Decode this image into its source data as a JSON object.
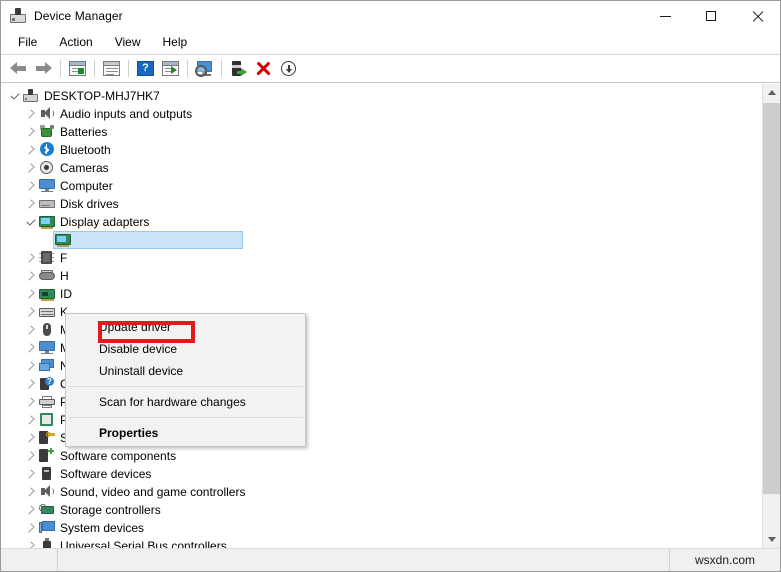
{
  "window": {
    "title": "Device Manager",
    "icon": "device-manager-icon",
    "controls": {
      "minimize": "–",
      "maximize": "□",
      "close": "✕"
    }
  },
  "menubar": {
    "items": [
      {
        "label": "File"
      },
      {
        "label": "Action"
      },
      {
        "label": "View"
      },
      {
        "label": "Help"
      }
    ]
  },
  "toolbar": {
    "buttons": [
      {
        "name": "back-arrow-icon"
      },
      {
        "name": "forward-arrow-icon"
      },
      {
        "name": "show-hide-console-tree-icon"
      },
      {
        "name": "properties-icon"
      },
      {
        "name": "help-icon"
      },
      {
        "name": "show-hidden-devices-icon"
      },
      {
        "name": "scan-for-hardware-changes-icon"
      },
      {
        "name": "update-driver-icon"
      },
      {
        "name": "uninstall-device-icon"
      },
      {
        "name": "disable-device-icon"
      }
    ]
  },
  "tree": {
    "root": {
      "label": "DESKTOP-MHJ7HK7",
      "icon": "computer-root-icon",
      "expanded": true
    },
    "items": [
      {
        "label": "Audio inputs and outputs",
        "icon": "speaker-icon",
        "expanded": false
      },
      {
        "label": "Batteries",
        "icon": "battery-icon",
        "expanded": false
      },
      {
        "label": "Bluetooth",
        "icon": "bluetooth-icon",
        "expanded": false
      },
      {
        "label": "Cameras",
        "icon": "camera-icon",
        "expanded": false
      },
      {
        "label": "Computer",
        "icon": "computer-icon",
        "expanded": false
      },
      {
        "label": "Disk drives",
        "icon": "disk-drive-icon",
        "expanded": false
      },
      {
        "label": "Display adapters",
        "icon": "display-adapter-icon",
        "expanded": true
      },
      {
        "label": "",
        "icon": "graphics-card-icon",
        "expanded": false,
        "child": true,
        "selected": true
      },
      {
        "label": "F",
        "icon": "firmware-icon",
        "expanded": false,
        "truncated": true
      },
      {
        "label": "H",
        "icon": "hid-icon",
        "expanded": false,
        "truncated": true
      },
      {
        "label": "ID",
        "icon": "ide-controller-icon",
        "expanded": false,
        "truncated": true
      },
      {
        "label": "K",
        "icon": "keyboard-icon",
        "expanded": false,
        "truncated": true
      },
      {
        "label": "M",
        "icon": "mouse-icon",
        "expanded": false,
        "truncated": true
      },
      {
        "label": "M",
        "icon": "monitor-icon",
        "expanded": false,
        "truncated": true
      },
      {
        "label": "Network adapters",
        "icon": "network-adapter-icon",
        "expanded": false
      },
      {
        "label": "Other devices",
        "icon": "other-device-icon",
        "expanded": false
      },
      {
        "label": "Print queues",
        "icon": "printer-icon",
        "expanded": false
      },
      {
        "label": "Processors",
        "icon": "processor-icon",
        "expanded": false
      },
      {
        "label": "Security devices",
        "icon": "security-device-icon",
        "expanded": false
      },
      {
        "label": "Software components",
        "icon": "software-component-icon",
        "expanded": false
      },
      {
        "label": "Software devices",
        "icon": "software-device-icon",
        "expanded": false
      },
      {
        "label": "Sound, video and game controllers",
        "icon": "sound-controller-icon",
        "expanded": false
      },
      {
        "label": "Storage controllers",
        "icon": "storage-controller-icon",
        "expanded": false
      },
      {
        "label": "System devices",
        "icon": "system-device-icon",
        "expanded": false
      },
      {
        "label": "Universal Serial Bus controllers",
        "icon": "usb-controller-icon",
        "expanded": false
      }
    ]
  },
  "context_menu": {
    "items": [
      {
        "label": "Update driver",
        "highlighted": true
      },
      {
        "label": "Disable device"
      },
      {
        "label": "Uninstall device"
      },
      {
        "separator": true
      },
      {
        "label": "Scan for hardware changes"
      },
      {
        "separator": true
      },
      {
        "label": "Properties",
        "bold": true
      }
    ],
    "highlight_color": "#e01b1b"
  },
  "scrollbar": {
    "up": "▲",
    "down": "▼"
  },
  "statusbar": {
    "watermark": "wsxdn.com"
  }
}
